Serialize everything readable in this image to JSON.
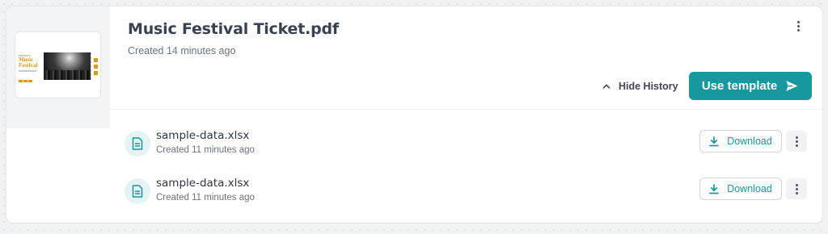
{
  "template": {
    "title": "Music Festival Ticket.pdf",
    "created": "Created 14 minutes ago",
    "thumbnail": {
      "small_text": "PRESENTS",
      "title_line1": "Music",
      "title_line2": "Festival"
    }
  },
  "actions": {
    "hide_history_label": "Hide History",
    "use_template_label": "Use template"
  },
  "history": [
    {
      "name": "sample-data.xlsx",
      "created": "Created 11 minutes ago",
      "download_label": "Download"
    },
    {
      "name": "sample-data.xlsx",
      "created": "Created 11 minutes ago",
      "download_label": "Download"
    }
  ],
  "icons": {
    "more": "more-vertical-icon",
    "chevron": "chevron-up-icon",
    "send": "send-icon",
    "file": "file-text-icon",
    "download": "download-icon"
  },
  "colors": {
    "accent": "#17989f",
    "accent_light": "#e4f3f4",
    "ticket_gold": "#d99a1a"
  }
}
